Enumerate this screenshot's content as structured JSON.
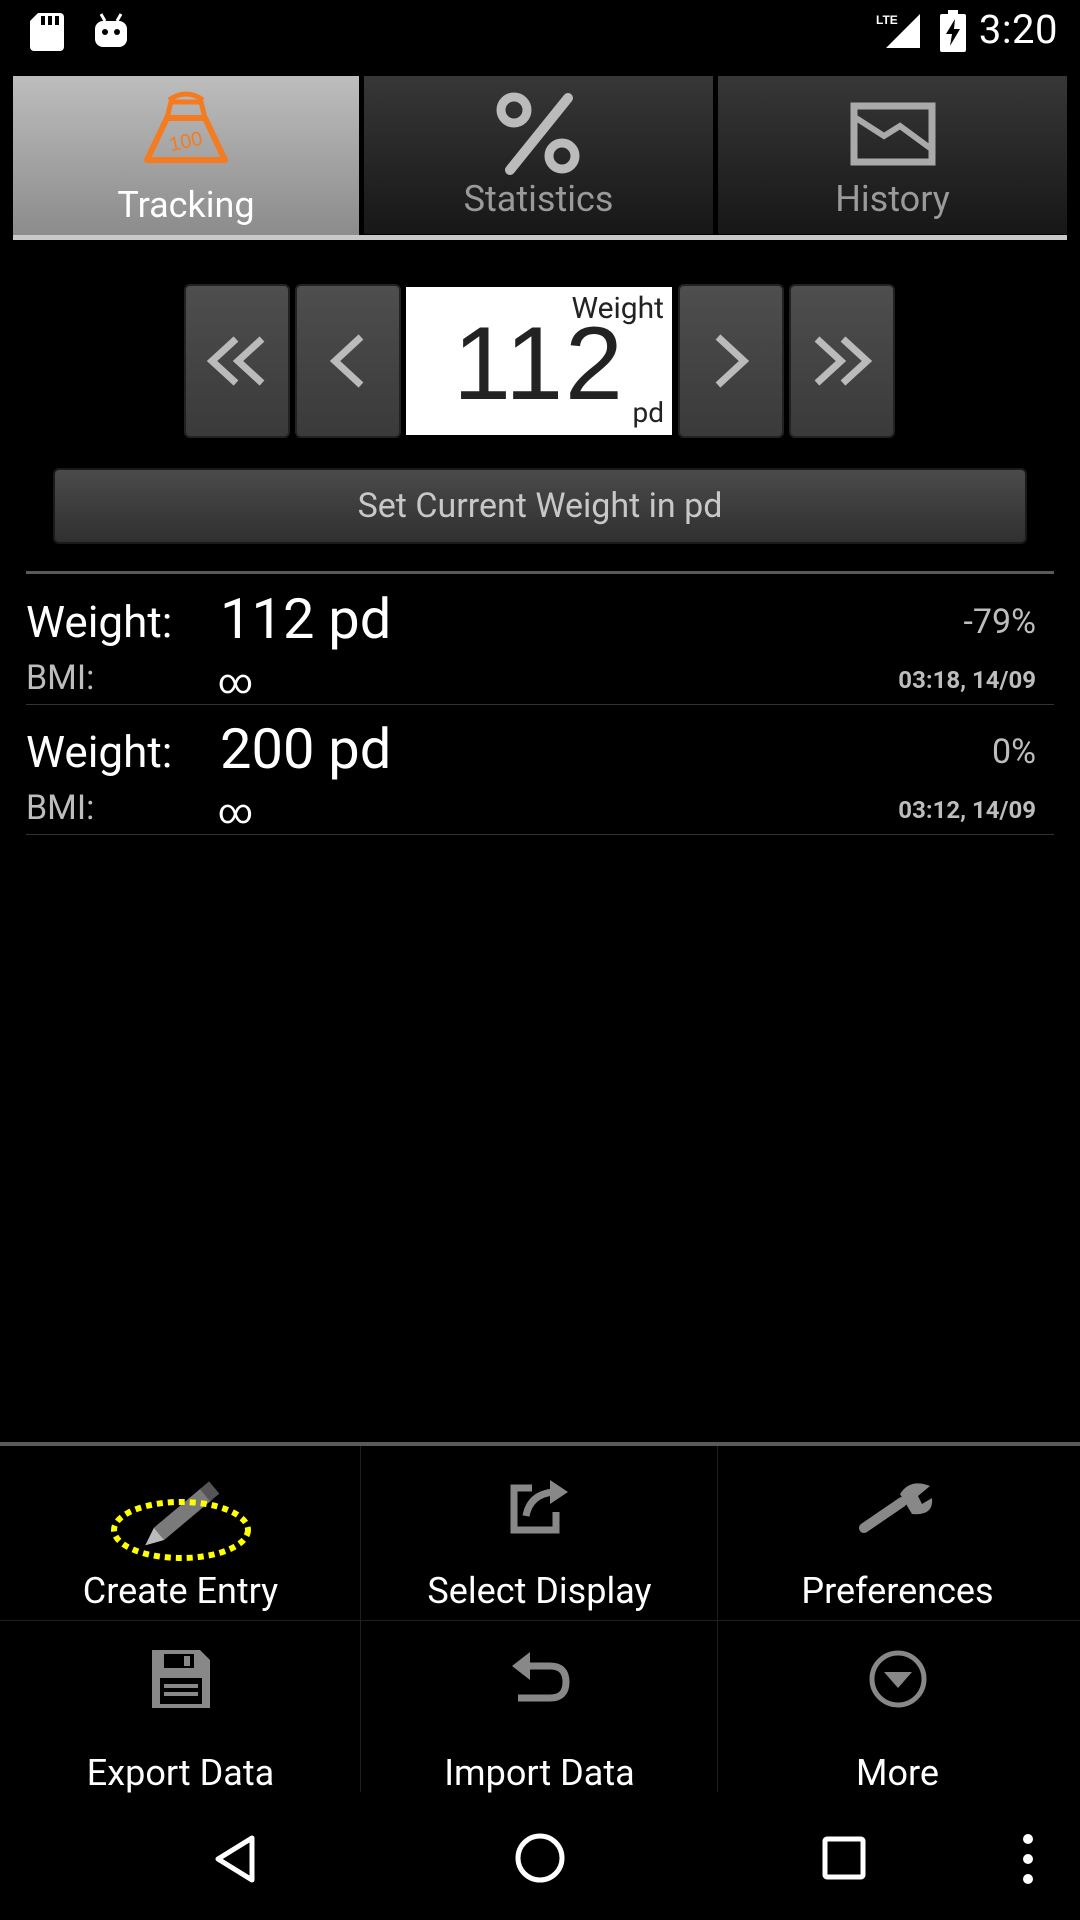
{
  "status_bar": {
    "time": "3:20",
    "network": "LTE",
    "icons": [
      "sd-card-icon",
      "android-icon",
      "lte-signal-icon",
      "battery-charging-icon"
    ]
  },
  "tabs": [
    {
      "label": "Tracking",
      "icon": "scale-weight-icon",
      "active": true
    },
    {
      "label": "Statistics",
      "icon": "percent-icon",
      "active": false
    },
    {
      "label": "History",
      "icon": "chart-image-icon",
      "active": false
    }
  ],
  "weight_control": {
    "label": "Weight",
    "value": "112",
    "unit": "pd",
    "buttons": [
      "rewind-icon",
      "previous-icon",
      "next-icon",
      "fast-forward-icon"
    ]
  },
  "set_weight_button": "Set Current Weight in pd",
  "entries": [
    {
      "weight_label": "Weight:",
      "weight_value": "112 pd",
      "percent": "-79%",
      "bmi_label": "BMI:",
      "bmi_value": "∞",
      "timestamp": "03:18, 14/09"
    },
    {
      "weight_label": "Weight:",
      "weight_value": "200 pd",
      "percent": "0%",
      "bmi_label": "BMI:",
      "bmi_value": "∞",
      "timestamp": "03:12, 14/09"
    }
  ],
  "menu": [
    {
      "label": "Create Entry",
      "icon": "pencil-icon"
    },
    {
      "label": "Select Display",
      "icon": "share-icon"
    },
    {
      "label": "Preferences",
      "icon": "wrench-icon"
    },
    {
      "label": "Export Data",
      "icon": "save-icon"
    },
    {
      "label": "Import Data",
      "icon": "undo-icon"
    },
    {
      "label": "More",
      "icon": "more-icon"
    }
  ],
  "nav_bar": [
    "back-icon",
    "home-icon",
    "recents-icon",
    "overflow-menu-icon"
  ],
  "colors": {
    "accent": "#f47b20",
    "highlight": "#ffff00",
    "background": "#000000"
  }
}
